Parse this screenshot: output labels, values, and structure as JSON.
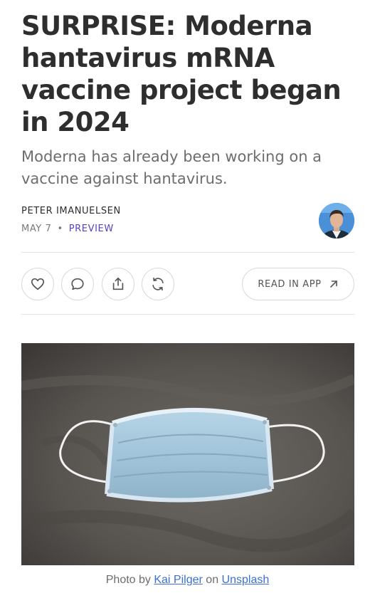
{
  "article": {
    "title": "SURPRISE: Moderna hantavirus mRNA vaccine project began in 2024",
    "subtitle": "Moderna has already been working on a vaccine against hantavirus.",
    "author": "PETER IMANUELSEN",
    "date": "MAY 7",
    "separator": "•",
    "access_label": "PREVIEW"
  },
  "actions": {
    "like_icon": "heart-icon",
    "comment_icon": "comment-icon",
    "share_icon": "share-icon",
    "restack_icon": "restack-icon",
    "read_in_app_label": "READ IN APP",
    "read_in_app_icon": "arrow-up-right-icon"
  },
  "image": {
    "subject": "face-mask-photo",
    "caption_prefix": "Photo by",
    "caption_author": "Kai Pilger",
    "caption_middle": "on",
    "caption_source": "Unsplash"
  },
  "colors": {
    "accent": "#5b3fc4",
    "link": "#3b6fd4",
    "title": "#2e2e2e",
    "muted": "#6d6d6d"
  }
}
